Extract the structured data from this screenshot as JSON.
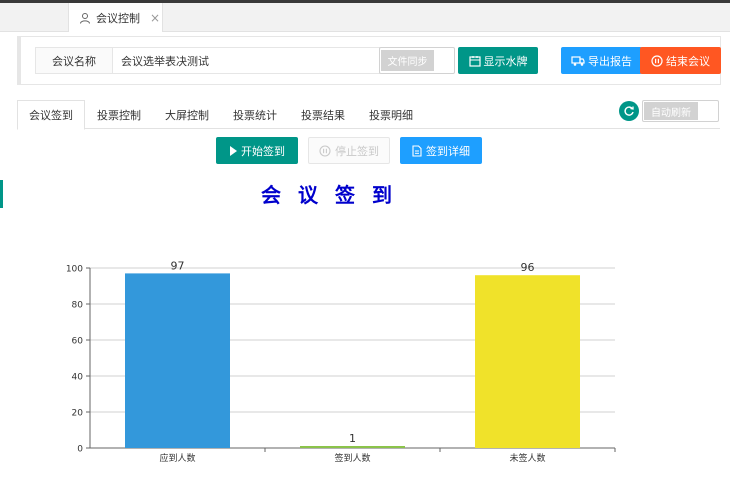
{
  "tab": {
    "label": "会议控制",
    "close": "×"
  },
  "meeting": {
    "name_label": "会议名称",
    "name_value": "会议选举表决测试",
    "sync_label": "文件同步",
    "watermark_label": "显示水牌",
    "export_label": "导出报告",
    "end_label": "结束会议"
  },
  "subtabs": [
    "会议签到",
    "投票控制",
    "大屏控制",
    "投票统计",
    "投票结果",
    "投票明细"
  ],
  "auto_refresh_label": "自动刷新",
  "actions": {
    "start_label": "开始签到",
    "stop_label": "停止签到",
    "detail_label": "签到详细"
  },
  "chart_title": "会议签到",
  "colors": {
    "green": "#009688",
    "blue": "#1e9fff",
    "orange": "#ff5722",
    "title": "#0000cc"
  },
  "chart_data": {
    "type": "bar",
    "categories": [
      "应到人数",
      "签到人数",
      "未签人数"
    ],
    "values": [
      97,
      1,
      96
    ],
    "colors": [
      "#3398db",
      "#8bc34a",
      "#f0e22a"
    ],
    "ylim": [
      0,
      100
    ],
    "yticks": [
      0,
      20,
      40,
      60,
      80,
      100
    ],
    "grid": true
  }
}
